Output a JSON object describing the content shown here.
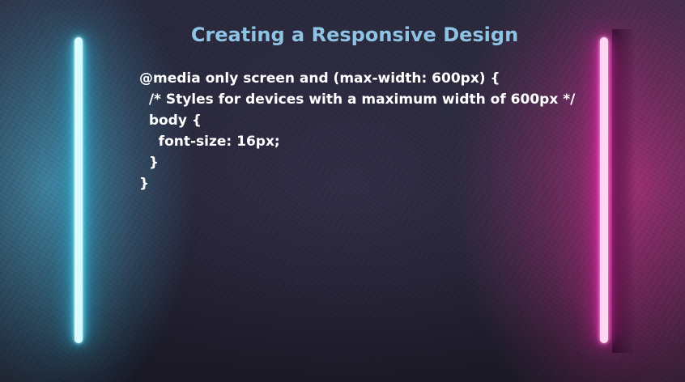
{
  "slide": {
    "title": "Creating a Responsive Design",
    "code_lines": [
      "@media only screen and (max-width: 600px) {",
      "  /* Styles for devices with a maximum width of 600px */",
      "  body {",
      "    font-size: 16px;",
      "  }",
      "}"
    ]
  },
  "colors": {
    "title": "#8ec3e3",
    "code_text": "#ffffff",
    "neon_left": "#4fe3ff",
    "neon_right": "#ff3fc4",
    "wall": "#232234"
  }
}
